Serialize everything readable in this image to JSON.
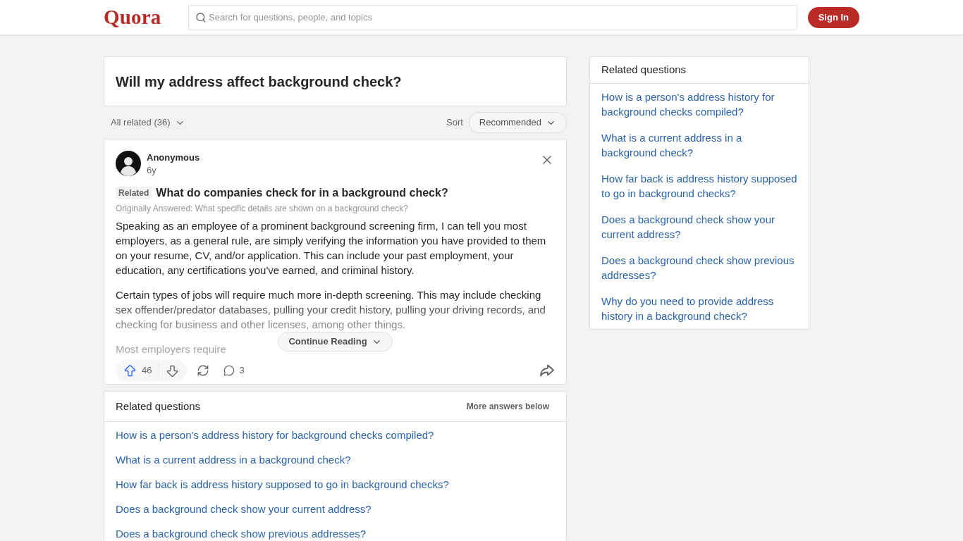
{
  "header": {
    "logo": "Quora",
    "search": {
      "placeholder": "Search for questions, people, and topics"
    },
    "sign_in_button": "Sign In"
  },
  "question": {
    "title": "Will my address affect background check?"
  },
  "filter_bar": {
    "filter": "All related (36)",
    "sort_label": "Sort",
    "sort_value": "Recommended"
  },
  "answer": {
    "author": "Anonymous",
    "age": "6y",
    "tag": "Related",
    "question": "What do companies check for in a background check?",
    "originally_answered": "Originally Answered: What specific details are shown on a background check?",
    "paragraphs": [
      "Speaking as an employee of a prominent background screening firm, I can tell you most employers, as a general rule, are simply verifying the information you have provided to them on your resume, CV, and/or application. This can include your past employment, your education, any certifications you've earned, and criminal history.",
      "Certain types of jobs will require much more in-depth screening. This may include checking sex offender/predator databases, pulling your credit history, pulling your driving records, and checking for business and other licenses, among other things."
    ],
    "faded_text": "Most employers require",
    "continue_button": "Continue Reading",
    "upvotes": "46",
    "comments": "3"
  },
  "related_questions": {
    "title": "Related questions",
    "note": "More answers below",
    "items": [
      "How is a person's address history for background checks compiled?",
      "What is a current address in a background check?",
      "How far back is address history supposed to go in background checks?",
      "Does a background check show your current address?",
      "Does a background check show previous addresses?"
    ]
  },
  "sidebar": {
    "title": "Related questions",
    "items": [
      "How is a person's address history for background checks compiled?",
      "What is a current address in a background check?",
      "How far back is address history supposed to go in background checks?",
      "Does a background check show your current address?",
      "Does a background check show previous addresses?",
      "Why do you need to provide address history in a background check?"
    ]
  }
}
